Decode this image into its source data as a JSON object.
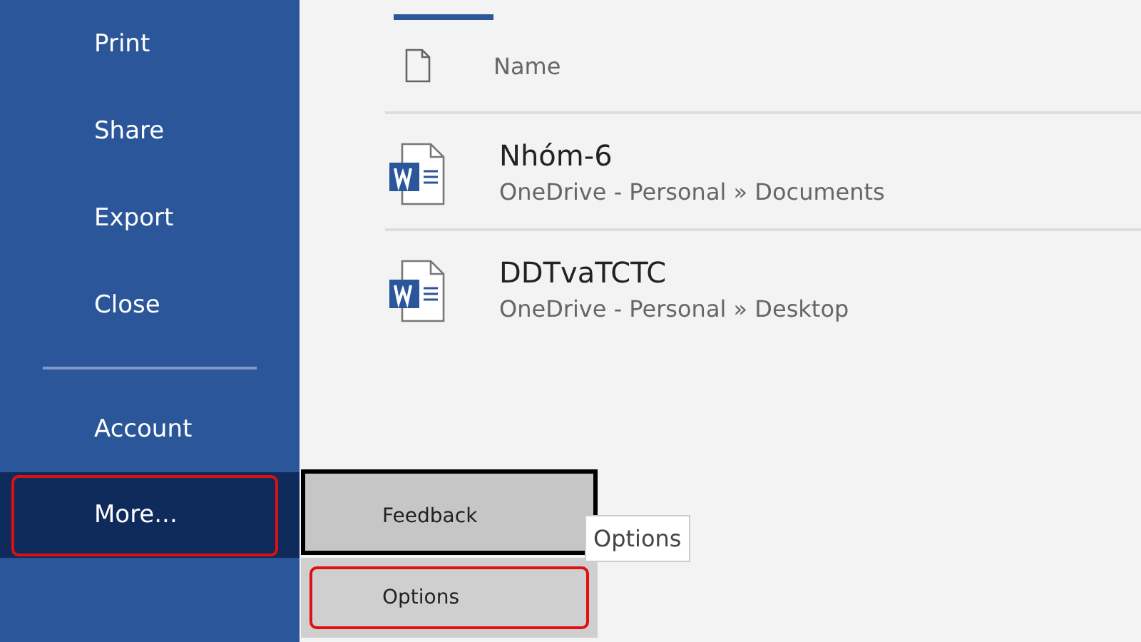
{
  "sidebar": {
    "items": [
      {
        "label": "Print",
        "selected": false,
        "highlighted": false
      },
      {
        "label": "Share",
        "selected": false,
        "highlighted": false
      },
      {
        "label": "Export",
        "selected": false,
        "highlighted": false
      },
      {
        "label": "Close",
        "selected": false,
        "highlighted": false
      },
      {
        "label": "Account",
        "selected": false,
        "highlighted": false
      },
      {
        "label": "More...",
        "selected": true,
        "highlighted": true
      }
    ]
  },
  "flyout": {
    "items": [
      {
        "label": "Feedback",
        "focused": true,
        "highlighted": false
      },
      {
        "label": "Options",
        "focused": false,
        "highlighted": true
      }
    ]
  },
  "tooltip": "Options",
  "file_list": {
    "column": "Name",
    "rows": [
      {
        "name": "Nhóm-6",
        "path": "OneDrive - Personal » Documents"
      },
      {
        "name": "DDTvaTCTC",
        "path": "OneDrive - Personal » Desktop"
      }
    ]
  }
}
